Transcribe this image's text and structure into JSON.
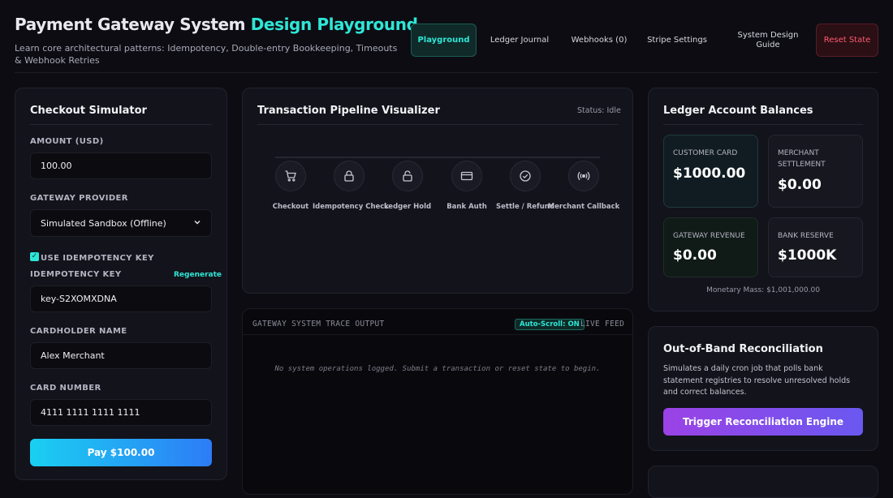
{
  "header": {
    "title_main": "Payment Gateway System",
    "title_highlight": "Design Playground",
    "subtitle": "Learn core architectural patterns: Idempotency, Double-entry Bookkeeping, Timeouts & Webhook Retries",
    "nav": {
      "playground": "Playground",
      "ledger_journal": "Ledger Journal",
      "webhooks": "Webhooks (0)",
      "stripe_settings": "Stripe Settings",
      "system_design_guide": "System Design Guide",
      "reset_state": "Reset State"
    }
  },
  "checkout": {
    "title": "Checkout Simulator",
    "amount_label": "AMOUNT (USD)",
    "amount_value": "100.00",
    "provider_label": "GATEWAY PROVIDER",
    "provider_value": "Simulated Sandbox (Offline)",
    "use_idempotency_label": "USE IDEMPOTENCY KEY",
    "use_idempotency_checked": true,
    "idempotency_label": "IDEMPOTENCY KEY",
    "regenerate": "Regenerate",
    "idempotency_value": "key-S2XOMXDNA",
    "cardholder_label": "CARDHOLDER NAME",
    "cardholder_value": "Alex Merchant",
    "card_number_label": "CARD NUMBER",
    "card_number_value": "4111 1111 1111 1111",
    "pay_button": "Pay $100.00"
  },
  "pipeline": {
    "title": "Transaction Pipeline Visualizer",
    "status": "Status: Idle",
    "steps": [
      "Checkout",
      "Idempotency Check",
      "Ledger Hold",
      "Bank Auth",
      "Settle / Refund",
      "Merchant Callback"
    ],
    "step_icons": [
      "cart-icon",
      "lock-icon",
      "lock-open-icon",
      "card-icon",
      "check-circle-icon",
      "broadcast-icon"
    ]
  },
  "trace": {
    "title": "GATEWAY SYSTEM TRACE OUTPUT",
    "autoscroll": "Auto-Scroll: ON",
    "live_feed": "LIVE FEED",
    "empty_message": "No system operations logged. Submit a transaction or reset state to begin."
  },
  "ledger": {
    "title": "Ledger Account Balances",
    "accounts": [
      {
        "label": "CUSTOMER CARD",
        "value": "$1000.00"
      },
      {
        "label": "MERCHANT SETTLEMENT",
        "value": "$0.00"
      },
      {
        "label": "GATEWAY REVENUE",
        "value": "$0.00"
      },
      {
        "label": "BANK RESERVE",
        "value": "$1000K"
      }
    ],
    "monetary_mass": "Monetary Mass: $1,001,000.00"
  },
  "reconciliation": {
    "title": "Out-of-Band Reconciliation",
    "description": "Simulates a daily cron job that polls bank statement registries to resolve unresolved holds and correct balances.",
    "button": "Trigger Reconciliation Engine"
  },
  "colors": {
    "accent": "#2ee6d6",
    "danger": "#ff5a6e",
    "pay_gradient_start": "#1ad0f2",
    "pay_gradient_end": "#2d7cf6",
    "recon_gradient_start": "#9b42e6",
    "recon_gradient_end": "#6a58f0"
  }
}
